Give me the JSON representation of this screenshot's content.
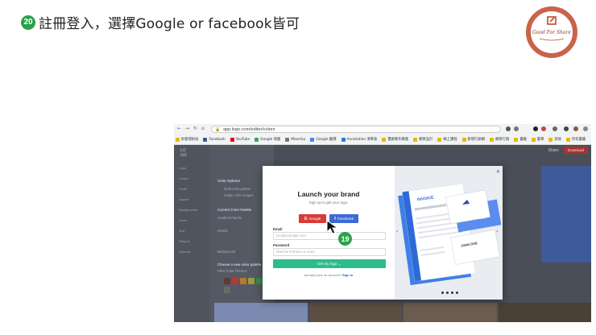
{
  "slide": {
    "step_number": "20",
    "title": "註冊登入，選擇Google or facebook皆可",
    "logo_text": "Good For Share",
    "pointer_step_number": "19"
  },
  "browser": {
    "url": "app.logo.com/editor/colors",
    "bookmarks": [
      "財會理財站",
      "Facebook",
      "YouTube",
      "Google 地圖",
      "Miserlou",
      "Google 翻譯",
      "Annotation 清單表",
      "畫廊製作模版",
      "網頁設計",
      "線上課程",
      "新增行銷網",
      "網頁行銷",
      "書籍",
      "書單",
      "其他",
      "所有書籤"
    ]
  },
  "app": {
    "sidebar_items": [
      "Logo",
      "Colors",
      "Fonts",
      "Layout",
      "Backgrounds",
      "Icons",
      "Text",
      "Shapes",
      "Uploads"
    ],
    "panel": {
      "heading": "Color Options",
      "option1": "Multi-color palette",
      "option2": "Single color images",
      "section2": "Current Color Palette",
      "line1": "Gradient Palette",
      "line2": "Simple",
      "line3": "Background",
      "section3": "Choose a new color palette",
      "line4": "Filter Color Themes"
    },
    "share_label": "Share",
    "download_label": "Download"
  },
  "modal": {
    "title": "Launch your brand",
    "subtitle": "Sign up to get your logo.",
    "google_label": "Google",
    "facebook_label": "Facebook",
    "email_label": "Email",
    "email_placeholder": "you@example.com",
    "password_label": "Password",
    "password_placeholder": "Must be 8 letters or more.",
    "submit_label": "Get my logo",
    "signin_prompt": "Already have an account?",
    "signin_link": "Sign in"
  },
  "preview": {
    "invoice_title": "INVOICE",
    "card_name": "JOHN DOE"
  },
  "colors": {
    "badge_green": "#2aa24a",
    "google_red": "#d93a3a",
    "facebook_blue": "#3d6ad6",
    "submit_green": "#2dbd8c",
    "logo_ring": "#c0492b"
  }
}
